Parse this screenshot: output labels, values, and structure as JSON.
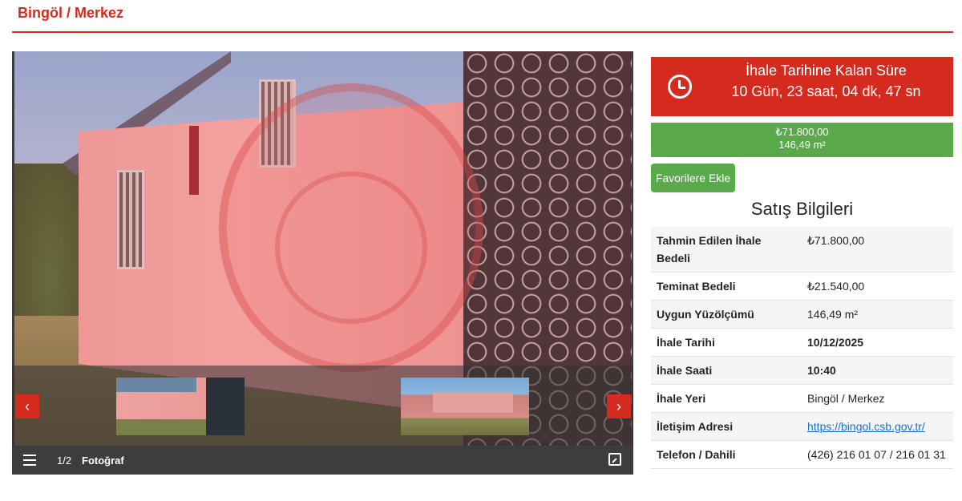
{
  "header": {
    "title": "Bingöl / Merkez"
  },
  "gallery": {
    "counter": "1/2",
    "label": "Fotoğraf",
    "prev_label": "‹",
    "next_label": "›",
    "icons": {
      "menu": "list-icon",
      "expand": "expand-icon"
    }
  },
  "countdown": {
    "title": "İhale Tarihine Kalan Süre",
    "value": "10 Gün, 23 saat, 04 dk, 47 sn"
  },
  "price_box": {
    "price": "₺71.800,00",
    "area": "146,49 m²"
  },
  "favorite_button": "Favorilere Ekle",
  "info": {
    "title": "Satış Bilgileri",
    "rows": [
      {
        "label": "Tahmin Edilen İhale Bedeli",
        "value": "₺71.800,00"
      },
      {
        "label": "Teminat Bedeli",
        "value": "₺21.540,00"
      },
      {
        "label": "Uygun Yüzölçümü",
        "value": "146,49 m²"
      },
      {
        "label": "İhale Tarihi",
        "value": "10/12/2025"
      },
      {
        "label": "İhale Saati",
        "value": "10:40"
      },
      {
        "label": "İhale Yeri",
        "value": "Bingöl / Merkez"
      },
      {
        "label": "İletişim Adresi",
        "value": "https://bingol.csb.gov.tr/"
      },
      {
        "label": "Telefon / Dahili",
        "value": "(426) 216 01 07 / 216 01 31"
      }
    ]
  },
  "colors": {
    "accent_red": "#d52b1e",
    "accent_green": "#5aa94b",
    "link": "#1a6fcc"
  }
}
